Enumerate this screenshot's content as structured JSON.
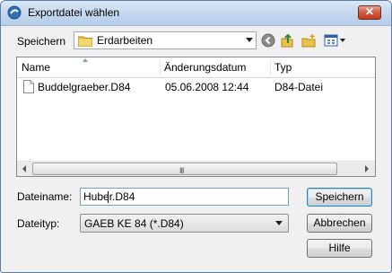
{
  "window": {
    "title": "Exportdatei wählen",
    "close_glyph": "✕"
  },
  "lookin": {
    "label": "Speichern",
    "value": "Erdarbeiten"
  },
  "toolbar": {
    "icons": [
      "back-icon",
      "up-folder-icon",
      "new-folder-icon",
      "view-menu-icon"
    ]
  },
  "filelist": {
    "columns": [
      {
        "label": "Name"
      },
      {
        "label": "Änderungsdatum"
      },
      {
        "label": "Typ"
      }
    ],
    "rows": [
      {
        "name": "Buddelgraeber.D84",
        "date": "05.06.2008 12:44",
        "type": "D84-Datei"
      }
    ],
    "scroll_grip": "III"
  },
  "filename": {
    "label": "Dateiname:",
    "value": "Huber.D84"
  },
  "filetype": {
    "label": "Dateityp:",
    "value": "GAEB KE 84 (*.D84)"
  },
  "buttons": {
    "save": "Speichern",
    "cancel": "Abbrechen",
    "help": "Hilfe"
  },
  "colors": {
    "title_gradient": "#c3d7ee",
    "close_red": "#c23b23",
    "default_button_border": "#3c7fb1"
  }
}
